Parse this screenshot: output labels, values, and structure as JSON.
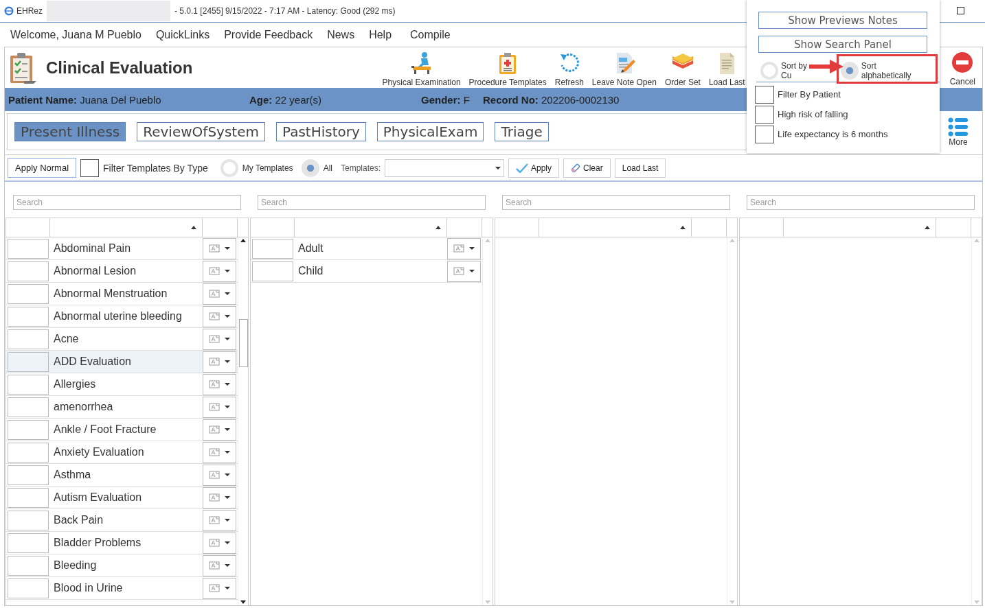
{
  "window": {
    "app": "EHRez",
    "title": "- 5.0.1 [2455] 9/15/2022 - 7:17 AM - Latency: Good (292 ms)"
  },
  "menu": [
    "Welcome, Juana M Pueblo",
    "QuickLinks",
    "Provide Feedback",
    "News",
    "Help",
    "Compile"
  ],
  "header": {
    "title": "Clinical Evaluation",
    "toolbar": [
      {
        "label": "Physical Examination",
        "kind": "exam"
      },
      {
        "label": "Procedure Templates",
        "kind": "clipboard"
      },
      {
        "label": "Refresh",
        "kind": "refresh"
      },
      {
        "label": "Leave Note Open",
        "kind": "note"
      },
      {
        "label": "Order Set",
        "kind": "layers"
      },
      {
        "label": "Load Last",
        "kind": "page"
      }
    ],
    "cancel": "Cancel",
    "more": "More"
  },
  "patient": [
    {
      "label": "Patient Name:",
      "value": "Juana Del Pueblo"
    },
    {
      "label": "Age:",
      "value": "22 year(s)"
    },
    {
      "label": "Gender:",
      "value": "F"
    },
    {
      "label": "Record No:",
      "value": "202206-0002130"
    }
  ],
  "tabs": [
    {
      "label": "Present Illness",
      "selected": true
    },
    {
      "label": "ReviewOfSystem",
      "selected": false
    },
    {
      "label": "PastHistory",
      "selected": false
    },
    {
      "label": "PhysicalExam",
      "selected": false
    },
    {
      "label": "Triage",
      "selected": false
    }
  ],
  "filter": {
    "apply_normal": "Apply Normal",
    "by_type": {
      "label": "Filter Templates By Type",
      "checked": false
    },
    "scope": [
      {
        "label": "My Templates",
        "selected": false
      },
      {
        "label": "All",
        "selected": true
      }
    ],
    "templates_label": "Templates:",
    "buttons": [
      {
        "label": "Apply",
        "kind": "check"
      },
      {
        "label": "Clear",
        "kind": "eraser"
      },
      {
        "label": "Load Last",
        "kind": "plain"
      }
    ]
  },
  "panels": [
    {
      "search": {
        "placeholder": "Search"
      },
      "scrollable": true,
      "rows": [
        {
          "name": "Abdominal Pain",
          "selected": false
        },
        {
          "name": "Abnormal Lesion",
          "selected": false
        },
        {
          "name": "Abnormal Menstruation",
          "selected": false
        },
        {
          "name": "Abnormal uterine bleeding",
          "selected": false
        },
        {
          "name": "Acne",
          "selected": false
        },
        {
          "name": "ADD Evaluation",
          "selected": true
        },
        {
          "name": "Allergies",
          "selected": false
        },
        {
          "name": "amenorrhea",
          "selected": false
        },
        {
          "name": "Ankle / Foot Fracture",
          "selected": false
        },
        {
          "name": "Anxiety Evaluation",
          "selected": false
        },
        {
          "name": "Asthma",
          "selected": false
        },
        {
          "name": "Autism Evaluation",
          "selected": false
        },
        {
          "name": "Back Pain",
          "selected": false
        },
        {
          "name": "Bladder Problems",
          "selected": false
        },
        {
          "name": "Bleeding",
          "selected": false
        },
        {
          "name": "Blood in Urine",
          "selected": false
        }
      ]
    },
    {
      "search": {
        "placeholder": "Search"
      },
      "scrollable": false,
      "rows": [
        {
          "name": "Adult",
          "selected": false
        },
        {
          "name": "Child",
          "selected": false
        }
      ]
    },
    {
      "search": {
        "placeholder": "Search"
      },
      "scrollable": false
    },
    {
      "search": {
        "placeholder": "Search"
      },
      "scrollable": false
    }
  ],
  "popup": {
    "buttons": [
      "Show Previews Notes",
      "Show Search Panel"
    ],
    "sort": [
      {
        "label": "Sort by Cu",
        "selected": false
      },
      {
        "label": "Sort alphabetically",
        "selected": true
      }
    ],
    "options": [
      {
        "label": "Filter By Patient",
        "checked": false
      },
      {
        "label": "High risk of falling",
        "checked": false
      },
      {
        "label": "Life expectancy is 6 months",
        "checked": false
      }
    ]
  }
}
